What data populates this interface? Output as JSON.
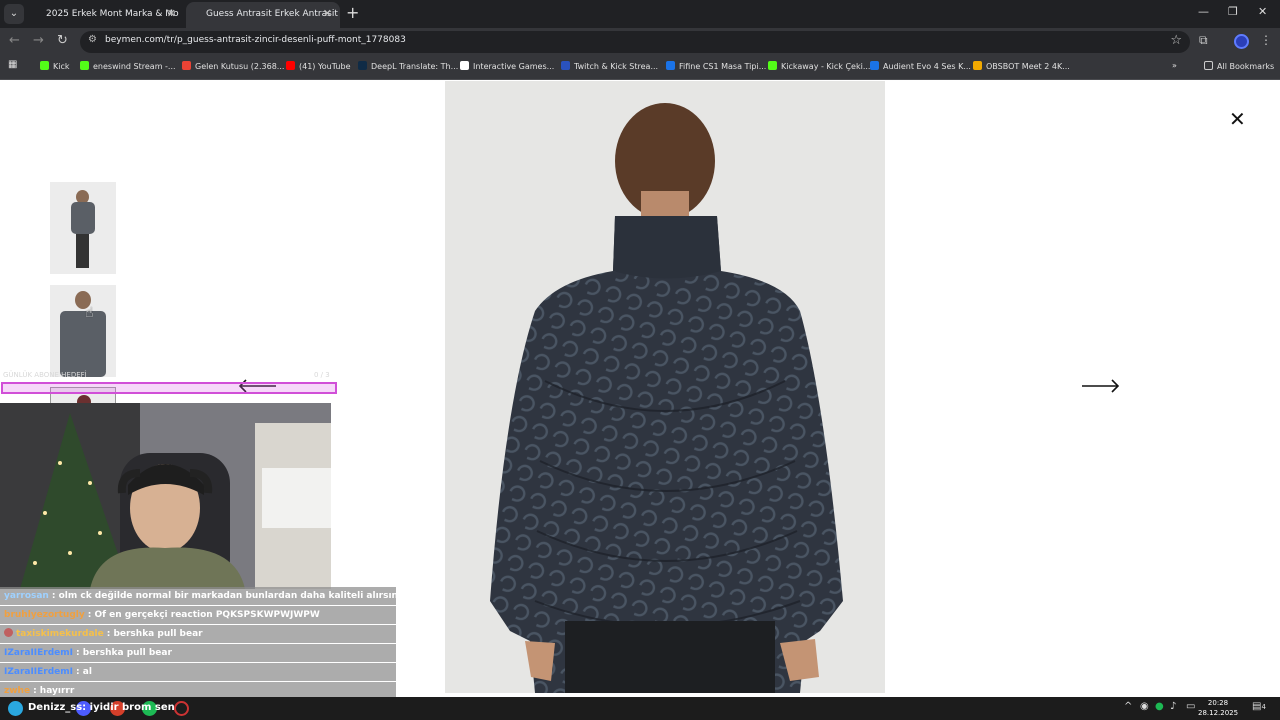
{
  "browser": {
    "tabs": [
      {
        "title": "2025 Erkek Mont Marka & Mo",
        "active": false
      },
      {
        "title": "Guess Antrasit Erkek Antrasit Zi",
        "active": true
      }
    ],
    "url": "beymen.com/tr/p_guess-antrasit-zincir-desenli-puff-mont_1778083",
    "bookmarks": [
      {
        "label": "Kick",
        "color": "#53fc18"
      },
      {
        "label": "eneswind Stream -...",
        "color": "#53fc18"
      },
      {
        "label": "Gelen Kutusu (2.368...",
        "color": "#ea4335"
      },
      {
        "label": "(41) YouTube",
        "color": "#ff0000"
      },
      {
        "label": "DeepL Translate: Th...",
        "color": "#0f2b46"
      },
      {
        "label": "Interactive Games...",
        "color": "#ffffff"
      },
      {
        "label": "Twitch & Kick Strea...",
        "color": "#2a52be"
      },
      {
        "label": "Fifine CS1 Masa Tipi...",
        "color": "#1a73e8"
      },
      {
        "label": "Kickaway - Kick Çeki...",
        "color": "#53fc18"
      },
      {
        "label": "Audient Evo 4 Ses K...",
        "color": "#1a73e8"
      },
      {
        "label": "OBSBOT Meet 2 4K...",
        "color": "#f2a900"
      }
    ],
    "all_bookmarks": "All Bookmarks"
  },
  "product": {
    "thumbnail_count": 3
  },
  "overlay": {
    "label": "GÜNLÜK ABONE HEDEFİ",
    "count": "0 / 3"
  },
  "chat": [
    {
      "user": "yarrosan",
      "user_color": "#9fd1ff",
      "message": ": olm ck değilde normal bir markadan bunlardan daha kaliteli alırsın",
      "badge": false
    },
    {
      "user": "bruhlyezortugly",
      "user_color": "#f0a040",
      "message": ": Of en gerçekçi reaction PQKSPSKWPWJWPW",
      "badge": false
    },
    {
      "user": "taxiskimekurdale",
      "user_color": "#f5c04a",
      "message": ": bershka pull bear",
      "badge": true
    },
    {
      "user": "IZaraIIErdemI",
      "user_color": "#4c8dff",
      "message": ": bershka pull bear",
      "badge": false
    },
    {
      "user": "IZaraIIErdemI",
      "user_color": "#4c8dff",
      "message": ": al",
      "badge": false
    },
    {
      "user": "zwhe",
      "user_color": "#f0a040",
      "message": ": hayırrr",
      "badge": false
    }
  ],
  "taskbar": {
    "subtitle": "Denizz_ss: iyidir brom sen",
    "time": "20:28",
    "date": "28.12.2025",
    "notification_count": "4"
  },
  "colors": {
    "overlay_bar_border": "#d14fd8",
    "chrome_dark": "#202124",
    "chrome_mid": "#35363a"
  }
}
